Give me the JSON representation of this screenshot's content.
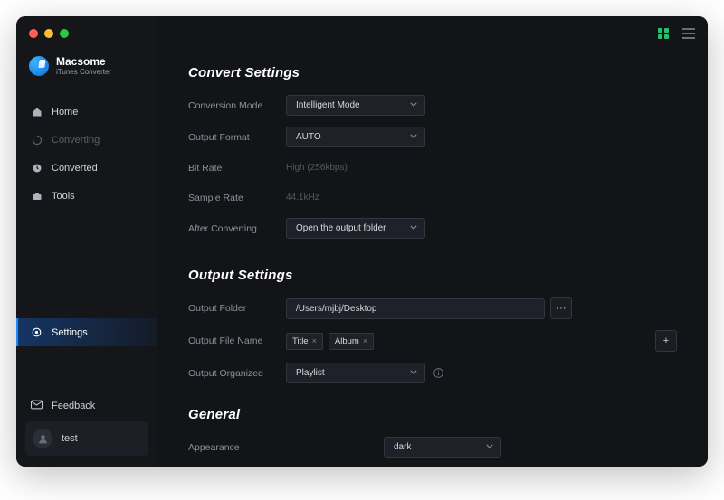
{
  "brand": {
    "name": "Macsome",
    "subtitle": "iTunes Converter"
  },
  "sidebar": {
    "items": [
      {
        "label": "Home"
      },
      {
        "label": "Converting"
      },
      {
        "label": "Converted"
      },
      {
        "label": "Tools"
      }
    ],
    "settings_label": "Settings",
    "feedback_label": "Feedback",
    "user_name": "test"
  },
  "convert": {
    "title": "Convert Settings",
    "mode_label": "Conversion Mode",
    "mode_value": "Intelligent Mode",
    "format_label": "Output Format",
    "format_value": "AUTO",
    "bitrate_label": "Bit Rate",
    "bitrate_value": "High (256kbps)",
    "samplerate_label": "Sample Rate",
    "samplerate_value": "44.1kHz",
    "after_label": "After Converting",
    "after_value": "Open the output folder"
  },
  "output": {
    "title": "Output Settings",
    "folder_label": "Output Folder",
    "folder_value": "/Users/mjbj/Desktop",
    "filename_label": "Output File Name",
    "tag1": "Title",
    "tag2": "Album",
    "organized_label": "Output Organized",
    "organized_value": "Playlist"
  },
  "general": {
    "title": "General",
    "appearance_label": "Appearance",
    "appearance_value": "dark"
  }
}
